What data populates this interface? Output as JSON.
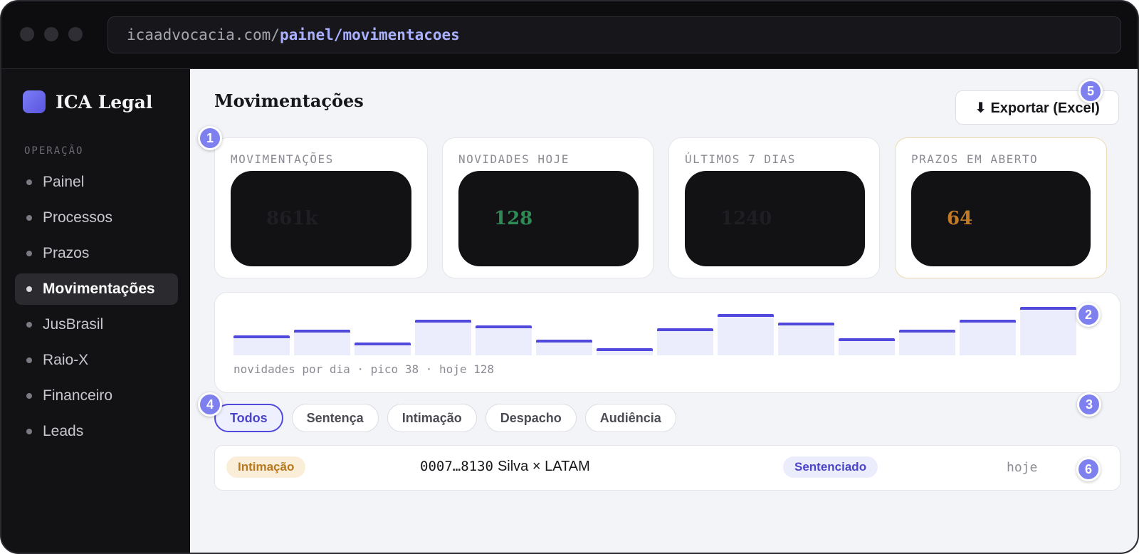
{
  "browser": {
    "url_host": "icaadvocacia.com/",
    "url_path": "painel/movimentacoes"
  },
  "sidebar": {
    "brand": "ICA Legal",
    "section_label": "OPERAÇÃO",
    "items": [
      {
        "label": "Painel",
        "active": false
      },
      {
        "label": "Processos",
        "active": false
      },
      {
        "label": "Prazos",
        "active": false
      },
      {
        "label": "Movimentações",
        "active": true
      },
      {
        "label": "JusBrasil",
        "active": false
      },
      {
        "label": "Raio-X",
        "active": false
      },
      {
        "label": "Financeiro",
        "active": false
      },
      {
        "label": "Leads",
        "active": false
      }
    ]
  },
  "header": {
    "title": "Movimentações",
    "export_label": "⬇ Exportar (Excel)"
  },
  "stats": [
    {
      "label": "MOVIMENTAÇÕES",
      "value": "861k",
      "color": "#1e1e23"
    },
    {
      "label": "NOVIDADES HOJE",
      "value": "128",
      "color": "#2f8a55"
    },
    {
      "label": "ÚLTIMOS 7 DIAS",
      "value": "1240",
      "color": "#1e1e23"
    },
    {
      "label": "PRAZOS EM ABERTO",
      "value": "64",
      "color": "#c27a25"
    }
  ],
  "chart_data": {
    "type": "bar",
    "series": [
      {
        "values": [
          14,
          18,
          9,
          25,
          21,
          11,
          5,
          19,
          29,
          23,
          12,
          18,
          25,
          34
        ]
      }
    ],
    "ylim": [
      0,
      38
    ],
    "caption": "novidades por dia · pico 38 · hoje 128"
  },
  "filters": [
    {
      "label": "Todos",
      "active": true
    },
    {
      "label": "Sentença",
      "active": false
    },
    {
      "label": "Intimação",
      "active": false
    },
    {
      "label": "Despacho",
      "active": false
    },
    {
      "label": "Audiência",
      "active": false
    }
  ],
  "rows": [
    {
      "type": "Intimação",
      "case_number": "0007…8130",
      "parties": "Silva × LATAM",
      "status": "Sentenciado",
      "time": "hoje"
    }
  ],
  "markers": [
    "1",
    "2",
    "3",
    "4",
    "5",
    "6"
  ]
}
